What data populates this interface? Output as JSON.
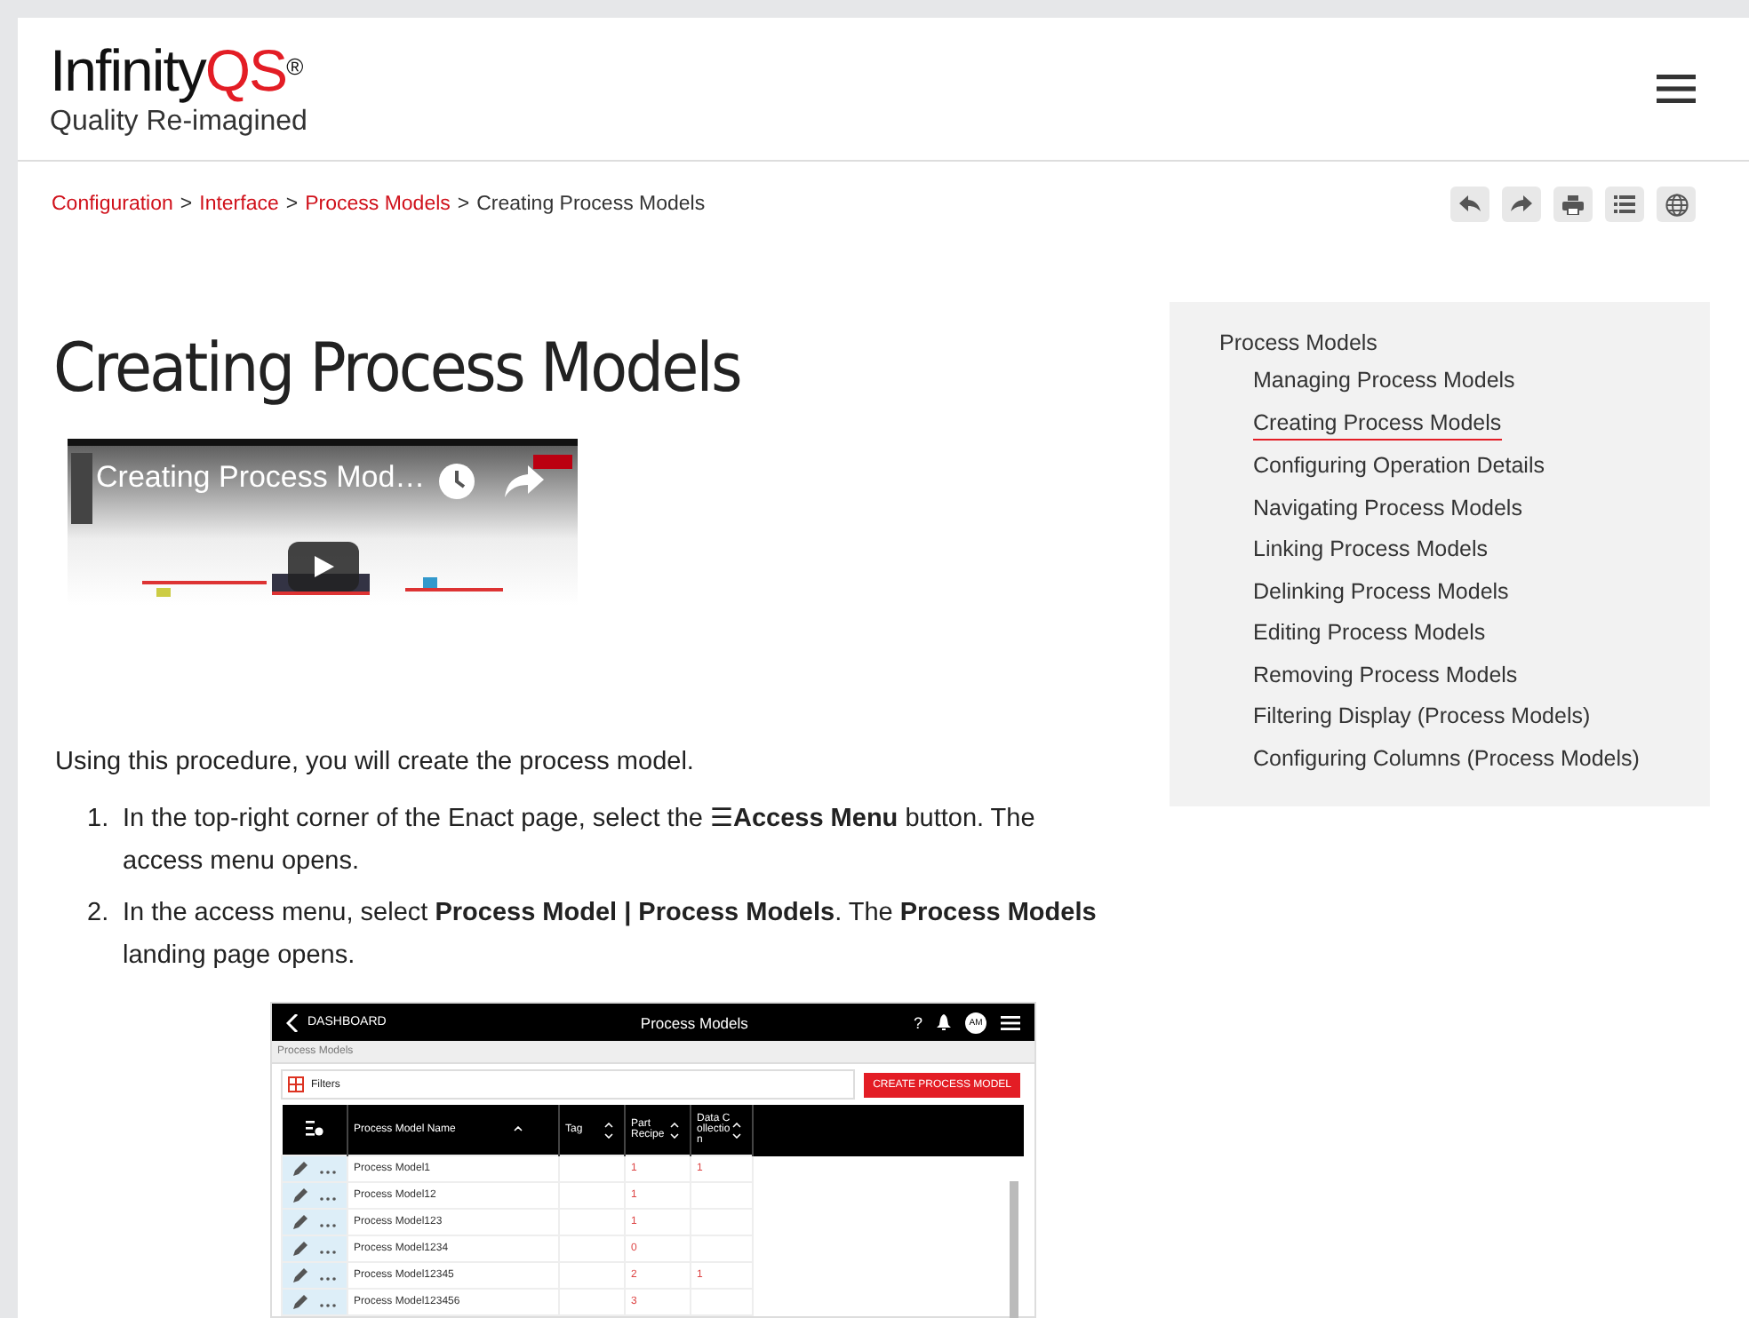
{
  "header": {
    "logo_main": "Infinity",
    "logo_accent": "QS",
    "logo_mark": "®",
    "tagline": "Quality Re-imagined"
  },
  "breadcrumb": [
    {
      "label": "Configuration",
      "kind": "link"
    },
    {
      "label": "Interface",
      "kind": "link"
    },
    {
      "label": "Process Models",
      "kind": "link"
    },
    {
      "label": "Creating Process Models",
      "kind": "current"
    }
  ],
  "breadcrumb_separator": ">",
  "title": "Creating Process Models",
  "video": {
    "title": "Creating Process Mod…"
  },
  "intro": "Using this procedure, you will create the process model.",
  "steps": [
    {
      "number": "1.",
      "kind": "plain",
      "after": "In the top-right corner of the Enact page, select the ☰**Access Menu** button. The access menu opens."
    },
    {
      "number": "2.",
      "kind": "plain",
      "after": "In the access menu, select **Process Model | Process Models**. The **Process Models** landing page opens."
    }
  ],
  "app_screenshot": {
    "back_label": "DASHBOARD",
    "title": "Process Models",
    "help": "?",
    "avatar": "AM",
    "breadcrumb": "Process Models",
    "filter_label": "Filters",
    "create_button": "CREATE PROCESS MODEL",
    "columns": [
      "Process Model Name",
      "Tag",
      "Part Recipe",
      "Data Collection"
    ],
    "rows": [
      {
        "name": "Process Model1",
        "tag": "",
        "part_recipe": "1",
        "data_collection": "1"
      },
      {
        "name": "Process Model12",
        "tag": "",
        "part_recipe": "1",
        "data_collection": ""
      },
      {
        "name": "Process Model123",
        "tag": "",
        "part_recipe": "1",
        "data_collection": ""
      },
      {
        "name": "Process Model1234",
        "tag": "",
        "part_recipe": "0",
        "data_collection": ""
      },
      {
        "name": "Process Model12345",
        "tag": "",
        "part_recipe": "2",
        "data_collection": "1"
      },
      {
        "name": "Process Model123456",
        "tag": "",
        "part_recipe": "3",
        "data_collection": ""
      }
    ]
  },
  "sidebar": {
    "heading": "Process Models",
    "items": [
      {
        "label": "Managing Process Models",
        "selected": false
      },
      {
        "label": "Creating Process Models",
        "selected": true
      },
      {
        "label": "Configuring Operation Details",
        "selected": false
      },
      {
        "label": "Navigating Process Models",
        "selected": false
      },
      {
        "label": "Linking Process Models",
        "selected": false
      },
      {
        "label": "Delinking Process Models",
        "selected": false
      },
      {
        "label": "Editing Process Models",
        "selected": false
      },
      {
        "label": "Removing Process Models",
        "selected": false
      },
      {
        "label": "Filtering Display (Process Models)",
        "selected": false
      },
      {
        "label": "Configuring Columns (Process Models)",
        "selected": false
      }
    ]
  }
}
